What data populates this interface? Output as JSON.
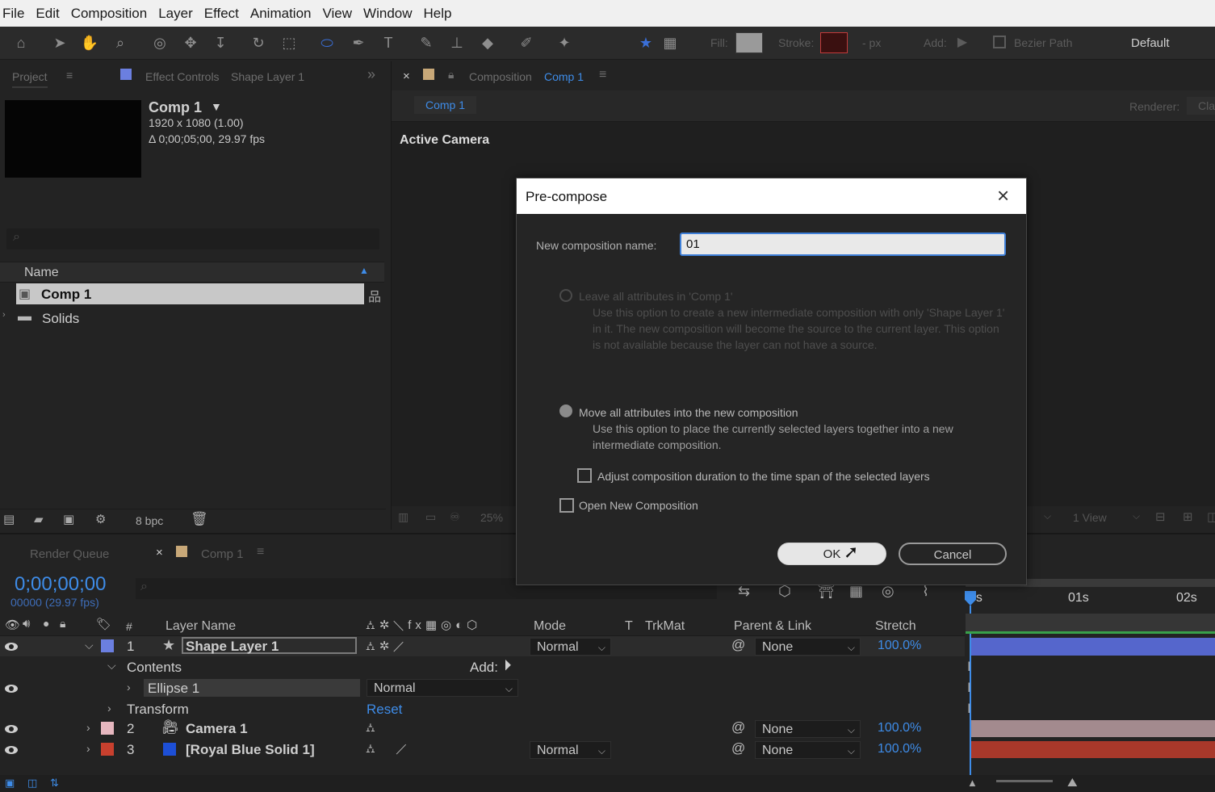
{
  "menu": [
    "File",
    "Edit",
    "Composition",
    "Layer",
    "Effect",
    "Animation",
    "View",
    "Window",
    "Help"
  ],
  "toolbar": {
    "fill_label": "Fill:",
    "stroke_label": "Stroke:",
    "stroke_units": "- px",
    "add_label": "Add:",
    "bezier_label": "Bezier Path",
    "workspace": "Default",
    "fill_color": "#9a9a9a",
    "stroke_color": "#c23a3a"
  },
  "project": {
    "tab_project": "Project",
    "tab_effect_controls": "Effect Controls",
    "tab_effect_target": "Shape Layer 1",
    "comp_name": "Comp 1",
    "comp_size": "1920 x 1080 (1.00)",
    "comp_duration": "Δ 0;00;05;00, 29.97 fps",
    "name_header": "Name",
    "items": [
      {
        "label": "Comp 1",
        "icon": "composition-icon"
      },
      {
        "label": "Solids",
        "icon": "folder-icon"
      }
    ],
    "bpc": "8 bpc"
  },
  "viewer": {
    "tab_composition": "Composition",
    "tab_comp_name": "Comp 1",
    "sub_tab": "Comp 1",
    "renderer_label": "Renderer:",
    "renderer_value": "Cla",
    "camera_label": "Active Camera",
    "zoom": "25%",
    "view_count": "1 View"
  },
  "dialog": {
    "title": "Pre-compose",
    "name_label": "New composition name:",
    "name_value": "01",
    "opt1_label": "Leave all attributes in 'Comp 1'",
    "opt1_desc": "Use this option to create a new intermediate composition with only 'Shape Layer 1' in it. The new composition will become the source to the current layer. This option is not available because the layer can not have a source.",
    "opt2_label": "Move all attributes into the new composition",
    "opt2_desc": "Use this option to place the currently selected layers together into a new intermediate composition.",
    "adjust_label": "Adjust composition duration to the time span of the selected layers",
    "open_label": "Open New Composition",
    "ok": "OK",
    "cancel": "Cancel"
  },
  "timeline": {
    "tab_render": "Render Queue",
    "tab_comp": "Comp 1",
    "timecode": "0;00;00;00",
    "frames": "00000 (29.97 fps)",
    "ruler": [
      "0s",
      "01s",
      "02s"
    ],
    "headers": {
      "num": "#",
      "layer_name": "Layer Name",
      "mode": "Mode",
      "t": "T",
      "trkmat": "TrkMat",
      "parent": "Parent & Link",
      "stretch": "Stretch"
    },
    "layers": [
      {
        "num": "1",
        "name": "Shape Layer 1",
        "mode": "Normal",
        "parent": "None",
        "stretch": "100.0%",
        "color": "#6b7fe0"
      },
      {
        "num": "2",
        "name": "Camera 1",
        "parent": "None",
        "stretch": "100.0%",
        "color": "#e6b7bf"
      },
      {
        "num": "3",
        "name": "[Royal Blue Solid 1]",
        "mode": "Normal",
        "parent": "None",
        "stretch": "100.0%",
        "color": "#c8402e"
      }
    ],
    "contents_label": "Contents",
    "add_label": "Add:",
    "ellipse_label": "Ellipse 1",
    "ellipse_mode": "Normal",
    "transform_label": "Transform",
    "reset_label": "Reset"
  }
}
